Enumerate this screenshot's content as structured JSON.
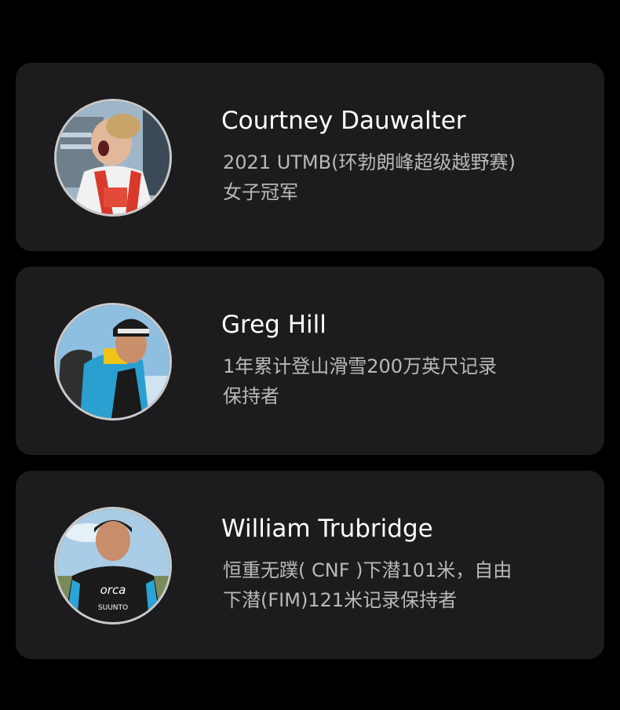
{
  "athletes": [
    {
      "name": "Courtney Dauwalter",
      "desc_line1": "2021 UTMB(环勃朗峰超级越野赛)",
      "desc_line2": "女子冠军",
      "avatar_icon": "runner-portrait"
    },
    {
      "name": "Greg Hill",
      "desc_line1": "1年累计登山滑雪200万英尺记录",
      "desc_line2": "保持者",
      "avatar_icon": "mountaineer-portrait"
    },
    {
      "name": "William Trubridge",
      "desc_line1": "恒重无蹼( CNF )下潜101米，自由",
      "desc_line2": "下潜(FIM)121米记录保持者",
      "avatar_icon": "freediver-portrait",
      "suit_text_1": "orca",
      "suit_text_2": "SUUNTO"
    }
  ],
  "colors": {
    "background": "#000000",
    "card": "#1c1c1e",
    "name_text": "#ffffff",
    "desc_text": "#b9b9b9",
    "avatar_ring": "#c9c9c9"
  }
}
